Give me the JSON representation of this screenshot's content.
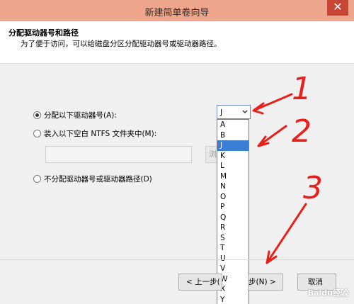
{
  "window": {
    "title": "新建简单卷向导",
    "close_glyph": "✕"
  },
  "header": {
    "title": "分配驱动器号和路径",
    "subtitle": "为了便于访问，可以给磁盘分区分配驱动器号或驱动器路径。"
  },
  "options": {
    "assign_letter": "分配以下驱动器号(A):",
    "mount_folder": "装入以下空白 NTFS 文件夹中(M):",
    "no_assign": "不分配驱动器号或驱动器路径(D)"
  },
  "browse_label": "浏",
  "drive_select": {
    "value": "J",
    "items": [
      "A",
      "B",
      "J",
      "K",
      "L",
      "M",
      "N",
      "O",
      "P",
      "Q",
      "R",
      "S",
      "T",
      "U",
      "V",
      "W",
      "X",
      "Y"
    ],
    "selected_index": 2
  },
  "buttons": {
    "back": "< 上一步(",
    "next": "步(N) >",
    "cancel": "取消"
  },
  "annotations": {
    "step1": "1",
    "step2": "2",
    "step3": "3",
    "color": "#e8201c"
  },
  "watermark": "Baidu经验"
}
